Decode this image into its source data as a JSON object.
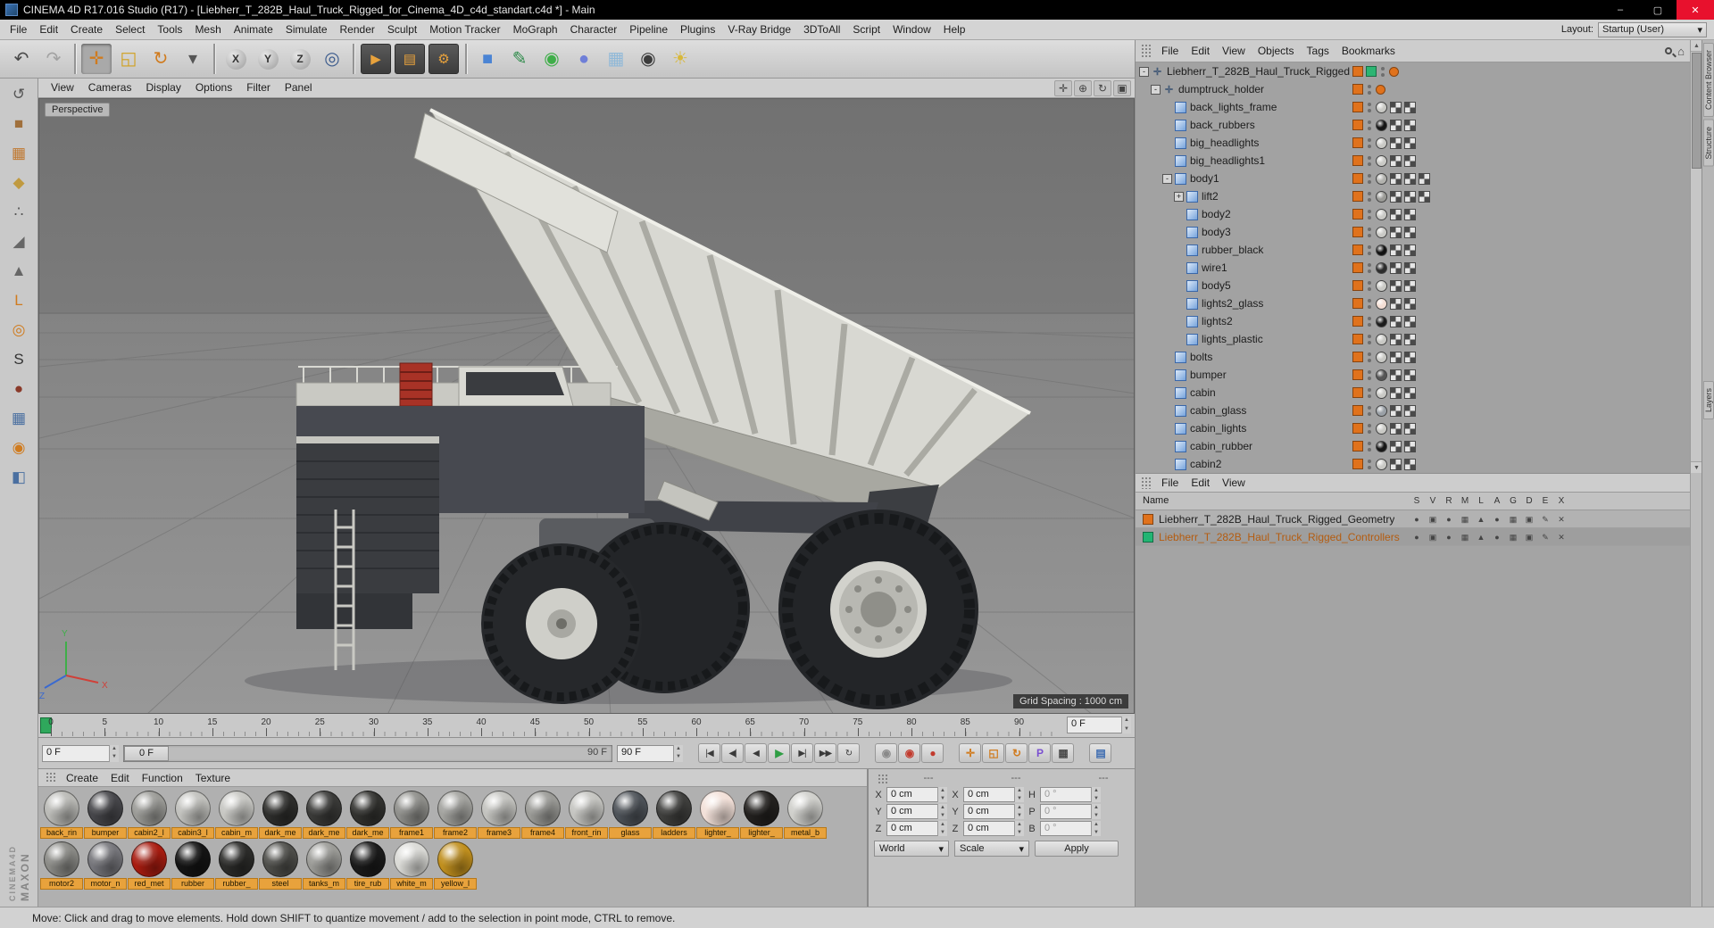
{
  "title_bar": {
    "title": "CINEMA 4D R17.016 Studio (R17) - [Liebherr_T_282B_Haul_Truck_Rigged_for_Cinema_4D_c4d_standart.c4d *] - Main",
    "minimize_glyph": "–",
    "maximize_glyph": "▢",
    "close_glyph": "✕"
  },
  "menu_bar": {
    "items": [
      "File",
      "Edit",
      "Create",
      "Select",
      "Tools",
      "Mesh",
      "Animate",
      "Simulate",
      "Render",
      "Sculpt",
      "Motion Tracker",
      "MoGraph",
      "Character",
      "Pipeline",
      "Plugins",
      "V-Ray Bridge",
      "3DToAll",
      "Script",
      "Window",
      "Help"
    ],
    "layout_label": "Layout:",
    "layout_value": "Startup (User)",
    "layout_arrow": "▾"
  },
  "toolbar": {
    "tools": [
      {
        "name": "undo-button",
        "glyph": "↶",
        "fg": "#4a4a4a"
      },
      {
        "name": "redo-button",
        "glyph": "↷",
        "fg": "#a2a2a2",
        "disabled": true
      },
      {
        "sep": true
      },
      {
        "name": "move-tool-button",
        "glyph": "✛",
        "fg": "#d07b1e",
        "pressed": true
      },
      {
        "name": "scale-tool-button",
        "glyph": "◱",
        "fg": "#d0a01e"
      },
      {
        "name": "rotate-tool-button",
        "glyph": "↻",
        "fg": "#d07b1e"
      },
      {
        "name": "last-tool-button",
        "glyph": "▾",
        "fg": "#555"
      },
      {
        "sep": true
      },
      {
        "name": "x-axis-lock-button",
        "glyph": "X",
        "circle": true
      },
      {
        "name": "y-axis-lock-button",
        "glyph": "Y",
        "circle": true
      },
      {
        "name": "z-axis-lock-button",
        "glyph": "Z",
        "circle": true
      },
      {
        "name": "coordinate-system-button",
        "glyph": "◎",
        "fg": "#3a5a8c"
      },
      {
        "sep": true
      },
      {
        "name": "render-view-button",
        "glyph": "▶",
        "fg": "#e8a23c",
        "dark": true
      },
      {
        "name": "render-picture-viewer-button",
        "glyph": "▤",
        "fg": "#e8a23c",
        "dark": true
      },
      {
        "name": "render-settings-button",
        "glyph": "⚙",
        "fg": "#e8a23c",
        "dark": true
      },
      {
        "sep": true
      },
      {
        "name": "add-cube-button",
        "glyph": "■",
        "fg": "#4a84d4"
      },
      {
        "name": "spline-pen-button",
        "glyph": "✎",
        "fg": "#2e8b4a"
      },
      {
        "name": "subdivision-surface-button",
        "glyph": "◉",
        "fg": "#3fae49"
      },
      {
        "name": "deformer-button",
        "glyph": "●",
        "fg": "#6f7fd8"
      },
      {
        "name": "environment-button",
        "glyph": "▦",
        "fg": "#8fb8d8"
      },
      {
        "name": "camera-button",
        "glyph": "◉",
        "fg": "#3c3c3c"
      },
      {
        "name": "light-button",
        "glyph": "☀",
        "fg": "#d8b83a"
      }
    ]
  },
  "left_toolbar": {
    "tools": [
      {
        "name": "make-editable-button",
        "glyph": "↺",
        "fg": "#555"
      },
      {
        "name": "model-mode-button",
        "glyph": "■",
        "fg": "#a0703c"
      },
      {
        "name": "texture-mode-button",
        "glyph": "▦",
        "fg": "#c07830"
      },
      {
        "name": "workplane-mode-button",
        "glyph": "◆",
        "fg": "#c09a40"
      },
      {
        "name": "points-mode-button",
        "glyph": "∴",
        "fg": "#555"
      },
      {
        "name": "edges-mode-button",
        "glyph": "◢",
        "fg": "#666"
      },
      {
        "name": "polygons-mode-button",
        "glyph": "▲",
        "fg": "#666"
      },
      {
        "name": "axis-mode-button",
        "glyph": "L",
        "fg": "#d07b1e"
      },
      {
        "name": "enable-axis-button",
        "glyph": "◎",
        "fg": "#d07b1e"
      },
      {
        "name": "snap-button",
        "glyph": "S",
        "fg": "#333"
      },
      {
        "name": "paint-tool-button",
        "glyph": "●",
        "fg": "#8a3a2a"
      },
      {
        "name": "lock-workplane-button",
        "glyph": "▦",
        "fg": "#4a6fa0"
      },
      {
        "name": "spline-smooth-button",
        "glyph": "◉",
        "fg": "#d07b1e"
      },
      {
        "name": "plugins-tool-button",
        "glyph": "◧",
        "fg": "#4a6fa0"
      }
    ]
  },
  "viewport": {
    "menu": [
      "View",
      "Cameras",
      "Display",
      "Options",
      "Filter",
      "Panel"
    ],
    "nav_icons": [
      {
        "name": "viewport-pan-icon",
        "glyph": "✛"
      },
      {
        "name": "viewport-zoom-icon",
        "glyph": "⊕"
      },
      {
        "name": "viewport-orbit-icon",
        "glyph": "↻"
      },
      {
        "name": "viewport-toggle-icon",
        "glyph": "▣"
      }
    ],
    "view_label": "Perspective",
    "grid_spacing_label": "Grid Spacing : 1000 cm",
    "axis": {
      "x": "X",
      "y": "Y",
      "z": "Z"
    }
  },
  "timeline": {
    "frames": [
      0,
      5,
      10,
      15,
      20,
      25,
      30,
      35,
      40,
      45,
      50,
      55,
      60,
      65,
      70,
      75,
      80,
      85,
      90
    ],
    "frame_box_value": "0 F"
  },
  "playback": {
    "current_value": "0 F",
    "slider_handle_label": "0 F",
    "slider_end_label": "90 F",
    "range_end_value": "90 F",
    "buttons": [
      {
        "name": "goto-start-button",
        "glyph": "|◀"
      },
      {
        "name": "previous-key-button",
        "glyph": "◀|"
      },
      {
        "name": "play-backwards-button",
        "glyph": "◀"
      },
      {
        "name": "play-button",
        "glyph": "▶",
        "fg": "#2f9e44"
      },
      {
        "name": "next-frame-button",
        "glyph": "▶|"
      },
      {
        "name": "goto-end-button",
        "glyph": "▶▶"
      },
      {
        "name": "loop-button",
        "glyph": "↻"
      },
      {
        "name": "sound-toggle-button",
        "glyph": "◉",
        "fg": "#8a8a8a",
        "gapBefore": true
      },
      {
        "name": "record-keyframe-button",
        "glyph": "◉",
        "fg": "#c23b2e"
      },
      {
        "name": "autokey-button",
        "glyph": "●",
        "fg": "#c23b2e"
      },
      {
        "name": "record-position-button",
        "glyph": "✛",
        "fg": "#d07b1e",
        "gapBefore": true
      },
      {
        "name": "record-scale-button",
        "glyph": "◱",
        "fg": "#d07b1e"
      },
      {
        "name": "record-rotation-button",
        "glyph": "↻",
        "fg": "#d07b1e"
      },
      {
        "name": "record-parameter-button",
        "glyph": "P",
        "fg": "#7a4fd0"
      },
      {
        "name": "keyframe-selection-button",
        "glyph": "▦",
        "fg": "#4a4a4a"
      },
      {
        "name": "timeline-mode-button",
        "glyph": "▤",
        "fg": "#3a6ab0",
        "gapBefore": true
      }
    ]
  },
  "materials": {
    "menu": [
      "Create",
      "Edit",
      "Function",
      "Texture"
    ],
    "row1": [
      {
        "name": "back_rin",
        "color": "#b9b9b5"
      },
      {
        "name": "bumper",
        "color": "#46464a"
      },
      {
        "name": "cabin2_l",
        "color": "#9a9a96"
      },
      {
        "name": "cabin3_l",
        "color": "#c0c0bc"
      },
      {
        "name": "cabin_m",
        "color": "#c6c6c2"
      },
      {
        "name": "dark_me",
        "color": "#2e2e2c"
      },
      {
        "name": "dark_me",
        "color": "#3a3a38"
      },
      {
        "name": "dark_me",
        "color": "#32322f"
      },
      {
        "name": "frame1",
        "color": "#8e8e8a"
      },
      {
        "name": "frame2",
        "color": "#a2a29e"
      },
      {
        "name": "frame3",
        "color": "#c2c2be"
      },
      {
        "name": "frame4",
        "color": "#9a9a96"
      },
      {
        "name": "front_rin",
        "color": "#c4c4c0"
      },
      {
        "name": "glass",
        "color": "#4d5258"
      },
      {
        "name": "ladders",
        "color": "#3f3f3d"
      },
      {
        "name": "lighter_",
        "color": "#f2e0d8"
      },
      {
        "name": "lighter_",
        "color": "#23211f"
      },
      {
        "name": "metal_b",
        "color": "#cfcfcb"
      }
    ],
    "row2": [
      {
        "name": "motor2",
        "color": "#8a8a86"
      },
      {
        "name": "motor_n",
        "color": "#75757a"
      },
      {
        "name": "red_met",
        "color": "#a81c10"
      },
      {
        "name": "rubber",
        "color": "#141414"
      },
      {
        "name": "rubber_",
        "color": "#2c2c2a"
      },
      {
        "name": "steel",
        "color": "#4e4e4a"
      },
      {
        "name": "tanks_m",
        "color": "#9a9a96"
      },
      {
        "name": "tire_rub",
        "color": "#1b1b1b"
      },
      {
        "name": "white_m",
        "color": "#d9d9d5"
      },
      {
        "name": "yellow_l",
        "color": "#c08f1e"
      }
    ]
  },
  "coordinates": {
    "headers": [
      "---",
      "---",
      "---"
    ],
    "rows": [
      {
        "pos_label": "X",
        "pos_value": "0 cm",
        "size_label": "X",
        "size_value": "0 cm",
        "rot_label": "H",
        "rot_value": "0 °"
      },
      {
        "pos_label": "Y",
        "pos_value": "0 cm",
        "size_label": "Y",
        "size_value": "0 cm",
        "rot_label": "P",
        "rot_value": "0 °"
      },
      {
        "pos_label": "Z",
        "pos_value": "0 cm",
        "size_label": "Z",
        "size_value": "0 cm",
        "rot_label": "B",
        "rot_value": "0 °"
      }
    ],
    "world_value": "World",
    "scale_value": "Scale",
    "apply_label": "Apply",
    "dd_arrow": "▾"
  },
  "object_manager": {
    "menu": [
      "File",
      "Edit",
      "View",
      "Objects",
      "Tags",
      "Bookmarks"
    ],
    "tree": [
      {
        "label": "Liebherr_T_282B_Haul_Truck_Rigged",
        "depth": 0,
        "exp": "-",
        "type": "rig",
        "tags": [
          "#e0721c",
          "#2cb573"
        ],
        "checkers": 0,
        "extra": "#e0721c"
      },
      {
        "label": "dumptruck_holder",
        "depth": 1,
        "exp": "-",
        "type": "null",
        "tags": [
          "#e0721c"
        ],
        "checkers": 0,
        "extra": "#e0721c"
      },
      {
        "label": "back_lights_frame",
        "depth": 2,
        "type": "mesh",
        "tags": [
          "#e0721c"
        ],
        "sphere": "#c9c9c5",
        "checkers": 2
      },
      {
        "label": "back_rubbers",
        "depth": 2,
        "type": "mesh",
        "tags": [
          "#e0721c"
        ],
        "sphere": "#161616",
        "checkers": 2
      },
      {
        "label": "big_headlights",
        "depth": 2,
        "type": "mesh",
        "tags": [
          "#e0721c"
        ],
        "sphere": "#cacac6",
        "checkers": 2
      },
      {
        "label": "big_headlights1",
        "depth": 2,
        "type": "mesh",
        "tags": [
          "#e0721c"
        ],
        "sphere": "#cacac6",
        "checkers": 2
      },
      {
        "label": "body1",
        "depth": 2,
        "exp": "-",
        "type": "mesh",
        "tags": [
          "#e0721c"
        ],
        "sphere": "#b2b2ae",
        "checkers": 3
      },
      {
        "label": "lift2",
        "depth": 3,
        "exp": "+",
        "type": "mesh",
        "tags": [
          "#e0721c"
        ],
        "sphere": "#9a9a96",
        "checkers": 3
      },
      {
        "label": "body2",
        "depth": 3,
        "type": "mesh",
        "tags": [
          "#e0721c"
        ],
        "sphere": "#cacac6",
        "checkers": 2
      },
      {
        "label": "body3",
        "depth": 3,
        "type": "mesh",
        "tags": [
          "#e0721c"
        ],
        "sphere": "#cacac6",
        "checkers": 2
      },
      {
        "label": "rubber_black",
        "depth": 3,
        "type": "mesh",
        "tags": [
          "#e0721c"
        ],
        "sphere": "#111111",
        "checkers": 2
      },
      {
        "label": "wire1",
        "depth": 3,
        "type": "mesh",
        "tags": [
          "#e0721c"
        ],
        "sphere": "#2c2c2c",
        "checkers": 2
      },
      {
        "label": "body5",
        "depth": 3,
        "type": "mesh",
        "tags": [
          "#e0721c"
        ],
        "sphere": "#cacac6",
        "checkers": 2
      },
      {
        "label": "lights2_glass",
        "depth": 3,
        "type": "mesh",
        "tags": [
          "#e0721c"
        ],
        "sphere": "#f4ded4",
        "checkers": 2
      },
      {
        "label": "lights2",
        "depth": 3,
        "type": "mesh",
        "tags": [
          "#e0721c"
        ],
        "sphere": "#1c1c1c",
        "checkers": 2
      },
      {
        "label": "lights_plastic",
        "depth": 3,
        "type": "mesh",
        "tags": [
          "#e0721c"
        ],
        "sphere": "#c9c9c5",
        "checkers": 2
      },
      {
        "label": "bolts",
        "depth": 2,
        "type": "mesh",
        "tags": [
          "#e0721c"
        ],
        "sphere": "#c9c9c5",
        "checkers": 2
      },
      {
        "label": "bumper",
        "depth": 2,
        "type": "mesh",
        "tags": [
          "#e0721c"
        ],
        "sphere": "#565656",
        "checkers": 2
      },
      {
        "label": "cabin",
        "depth": 2,
        "type": "mesh",
        "tags": [
          "#e0721c"
        ],
        "sphere": "#cacac6",
        "checkers": 2
      },
      {
        "label": "cabin_glass",
        "depth": 2,
        "type": "mesh",
        "tags": [
          "#e0721c"
        ],
        "sphere": "#9aa0a6",
        "checkers": 2
      },
      {
        "label": "cabin_lights",
        "depth": 2,
        "type": "mesh",
        "tags": [
          "#e0721c"
        ],
        "sphere": "#cacac6",
        "checkers": 2
      },
      {
        "label": "cabin_rubber",
        "depth": 2,
        "type": "mesh",
        "tags": [
          "#e0721c"
        ],
        "sphere": "#161616",
        "checkers": 2
      },
      {
        "label": "cabin2",
        "depth": 2,
        "type": "mesh",
        "tags": [
          "#e0721c"
        ],
        "sphere": "#cacac6",
        "checkers": 2
      }
    ]
  },
  "layer_manager": {
    "menu": [
      "File",
      "Edit",
      "View"
    ],
    "name_header": "Name",
    "columns": [
      "S",
      "V",
      "R",
      "M",
      "L",
      "A",
      "G",
      "D",
      "E",
      "X"
    ],
    "cell_icons": [
      {
        "name": "solo-icon",
        "glyph": "●"
      },
      {
        "name": "view-icon",
        "glyph": "▣"
      },
      {
        "name": "render-icon",
        "glyph": "●"
      },
      {
        "name": "manager-icon",
        "glyph": "▦"
      },
      {
        "name": "lock-icon",
        "glyph": "▲"
      },
      {
        "name": "animation-icon",
        "glyph": "●"
      },
      {
        "name": "generators-icon",
        "glyph": "▦"
      },
      {
        "name": "deformers-icon",
        "glyph": "▣"
      },
      {
        "name": "expressions-icon",
        "glyph": "✎"
      },
      {
        "name": "xref-icon",
        "glyph": "✕"
      }
    ],
    "rows": [
      {
        "label": "Liebherr_T_282B_Haul_Truck_Rigged_Geometry",
        "swatch": "#e0721c",
        "selected": false
      },
      {
        "label": "Liebherr_T_282B_Haul_Truck_Rigged_Controllers",
        "swatch": "#22b573",
        "selected": true
      }
    ]
  },
  "side_tabs": {
    "top": [
      "Content Browser",
      "Structure"
    ],
    "bottom": [
      "Layers"
    ]
  },
  "branding": {
    "line1": "MAXON",
    "line2": "CINEMA4D"
  },
  "status_bar": {
    "text": "Move: Click and drag to move elements. Hold down SHIFT to quantize movement / add to the selection in point mode, CTRL to remove."
  }
}
